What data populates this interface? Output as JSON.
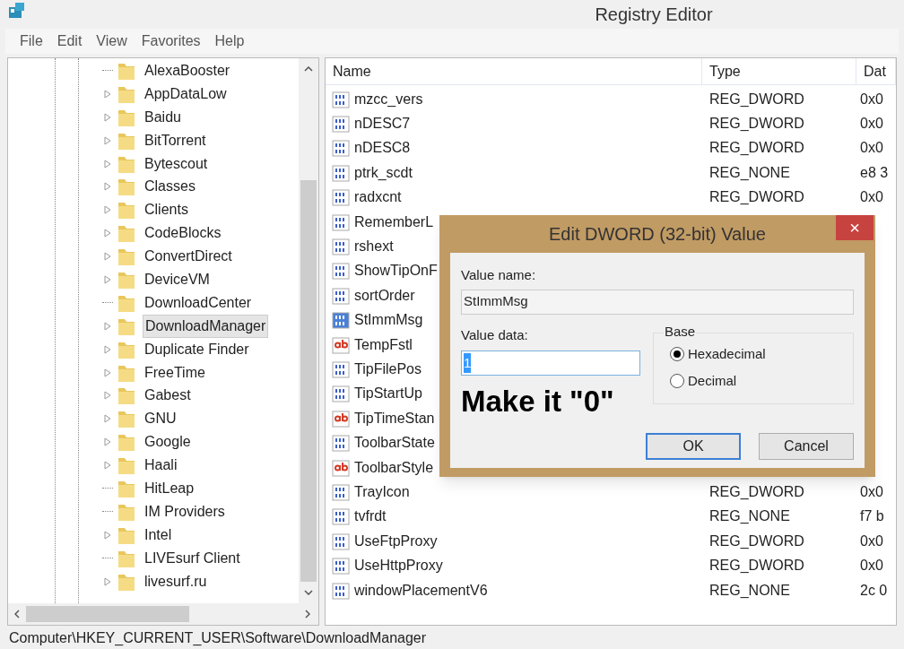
{
  "window": {
    "title": "Registry Editor"
  },
  "menu": [
    "File",
    "Edit",
    "View",
    "Favorites",
    "Help"
  ],
  "tree": {
    "items": [
      {
        "label": "AlexaBooster",
        "expandable": false,
        "selected": false
      },
      {
        "label": "AppDataLow",
        "expandable": true,
        "selected": false
      },
      {
        "label": "Baidu",
        "expandable": true,
        "selected": false
      },
      {
        "label": "BitTorrent",
        "expandable": true,
        "selected": false
      },
      {
        "label": "Bytescout",
        "expandable": true,
        "selected": false
      },
      {
        "label": "Classes",
        "expandable": true,
        "selected": false
      },
      {
        "label": "Clients",
        "expandable": true,
        "selected": false
      },
      {
        "label": "CodeBlocks",
        "expandable": true,
        "selected": false
      },
      {
        "label": "ConvertDirect",
        "expandable": true,
        "selected": false
      },
      {
        "label": "DeviceVM",
        "expandable": true,
        "selected": false
      },
      {
        "label": "DownloadCenter",
        "expandable": false,
        "selected": false
      },
      {
        "label": "DownloadManager",
        "expandable": true,
        "selected": true
      },
      {
        "label": "Duplicate Finder",
        "expandable": true,
        "selected": false
      },
      {
        "label": "FreeTime",
        "expandable": true,
        "selected": false
      },
      {
        "label": "Gabest",
        "expandable": true,
        "selected": false
      },
      {
        "label": "GNU",
        "expandable": true,
        "selected": false
      },
      {
        "label": "Google",
        "expandable": true,
        "selected": false
      },
      {
        "label": "Haali",
        "expandable": true,
        "selected": false
      },
      {
        "label": "HitLeap",
        "expandable": false,
        "selected": false
      },
      {
        "label": "IM Providers",
        "expandable": false,
        "selected": false
      },
      {
        "label": "Intel",
        "expandable": true,
        "selected": false
      },
      {
        "label": "LIVEsurf Client",
        "expandable": false,
        "selected": false
      },
      {
        "label": "livesurf.ru",
        "expandable": true,
        "selected": false
      }
    ]
  },
  "values": {
    "columns": [
      "Name",
      "Type",
      "Dat"
    ],
    "rows": [
      {
        "kind": "binary",
        "name": "mzcc_vers",
        "type": "REG_DWORD",
        "data": "0x0",
        "selected": false
      },
      {
        "kind": "binary",
        "name": "nDESC7",
        "type": "REG_DWORD",
        "data": "0x0",
        "selected": false
      },
      {
        "kind": "binary",
        "name": "nDESC8",
        "type": "REG_DWORD",
        "data": "0x0",
        "selected": false
      },
      {
        "kind": "binary",
        "name": "ptrk_scdt",
        "type": "REG_NONE",
        "data": "e8 3",
        "selected": false
      },
      {
        "kind": "binary",
        "name": "radxcnt",
        "type": "REG_DWORD",
        "data": "0x0",
        "selected": false
      },
      {
        "kind": "binary",
        "name": "RememberL",
        "selected": false
      },
      {
        "kind": "binary",
        "name": "rshext",
        "selected": false
      },
      {
        "kind": "binary",
        "name": "ShowTipOnF",
        "selected": false
      },
      {
        "kind": "binary",
        "name": "sortOrder",
        "selected": false
      },
      {
        "kind": "binary",
        "name": "StImmMsg",
        "selected": true
      },
      {
        "kind": "string",
        "name": "TempFstl",
        "selected": false
      },
      {
        "kind": "binary",
        "name": "TipFilePos",
        "selected": false
      },
      {
        "kind": "binary",
        "name": "TipStartUp",
        "selected": false
      },
      {
        "kind": "string",
        "name": "TipTimeStan",
        "selected": false
      },
      {
        "kind": "binary",
        "name": "ToolbarState",
        "selected": false
      },
      {
        "kind": "string",
        "name": "ToolbarStyle",
        "selected": false
      },
      {
        "kind": "binary",
        "name": "TrayIcon",
        "type": "REG_DWORD",
        "data": "0x0",
        "selected": false
      },
      {
        "kind": "binary",
        "name": "tvfrdt",
        "type": "REG_NONE",
        "data": "f7 b",
        "selected": false
      },
      {
        "kind": "binary",
        "name": "UseFtpProxy",
        "type": "REG_DWORD",
        "data": "0x0",
        "selected": false
      },
      {
        "kind": "binary",
        "name": "UseHttpProxy",
        "type": "REG_DWORD",
        "data": "0x0",
        "selected": false
      },
      {
        "kind": "binary",
        "name": "windowPlacementV6",
        "type": "REG_NONE",
        "data": "2c 0",
        "selected": false
      }
    ]
  },
  "status_bar": "Computer\\HKEY_CURRENT_USER\\Software\\DownloadManager",
  "dialog": {
    "title": "Edit DWORD (32-bit) Value",
    "close": "×",
    "value_name_label": "Value name:",
    "value_name": "StImmMsg",
    "value_data_label": "Value data:",
    "value_data": "1",
    "base_label": "Base",
    "base_options": [
      {
        "label": "Hexadecimal",
        "selected": true
      },
      {
        "label": "Decimal",
        "selected": false
      }
    ],
    "annotation": "Make it \"0\"",
    "buttons": [
      {
        "label": "OK",
        "default": true
      },
      {
        "label": "Cancel",
        "default": false
      }
    ]
  }
}
